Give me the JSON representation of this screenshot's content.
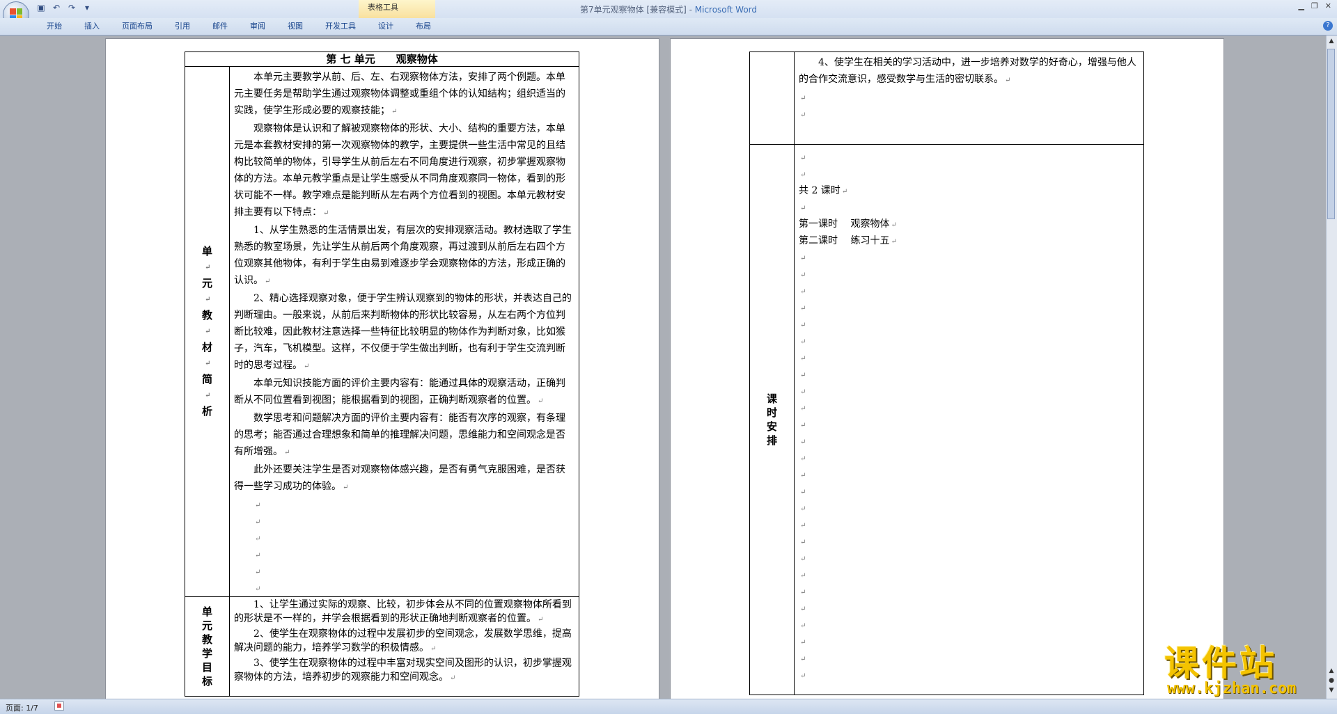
{
  "titlebar": {
    "doc_name": "第7单元观察物体 [兼容模式]",
    "separator": " - ",
    "app_name": "Microsoft Word",
    "context_group": "表格工具"
  },
  "quick_access": {
    "save_icon": "save-icon",
    "undo_icon": "undo-icon",
    "redo_icon": "redo-icon"
  },
  "ribbon": {
    "tabs": [
      "开始",
      "插入",
      "页面布局",
      "引用",
      "邮件",
      "审阅",
      "视图",
      "开发工具",
      "设计",
      "布局"
    ]
  },
  "page1": {
    "title": "第 七 单元　　观察物体",
    "section1_label": [
      "单",
      "元",
      "教",
      "材",
      "简",
      "析"
    ],
    "section1_paragraphs": [
      "本单元主要教学从前、后、左、右观察物体方法，安排了两个例题。本单元主要任务是帮助学生通过观察物体调整或重组个体的认知结构；组织适当的实践，使学生形成必要的观察技能；",
      "观察物体是认识和了解被观察物体的形状、大小、结构的重要方法，本单元是本套教材安排的第一次观察物体的教学，主要提供一些生活中常见的且结构比较简单的物体，引导学生从前后左右不同角度进行观察，初步掌握观察物体的方法。本单元教学重点是让学生感受从不同角度观察同一物体，看到的形状可能不一样。教学难点是能判断从左右两个方位看到的视图。本单元教材安排主要有以下特点：",
      "1、从学生熟悉的生活情景出发，有层次的安排观察活动。教材选取了学生熟悉的教室场景，先让学生从前后两个角度观察，再过渡到从前后左右四个方位观察其他物体，有利于学生由易到难逐步学会观察物体的方法，形成正确的认识。",
      "2、精心选择观察对象，便于学生辨认观察到的物体的形状，并表达自己的判断理由。一般来说，从前后来判断物体的形状比较容易，从左右两个方位判断比较难，因此教材注意选择一些特征比较明显的物体作为判断对象，比如猴子，汽车，飞机模型。这样，不仅便于学生做出判断，也有利于学生交流判断时的思考过程。",
      "本单元知识技能方面的评价主要内容有：能通过具体的观察活动，正确判断从不同位置看到视图；能根据看到的视图，正确判断观察者的位置。",
      "数学思考和问题解决方面的评价主要内容有：能否有次序的观察，有条理的思考；能否通过合理想象和简单的推理解决问题，思维能力和空间观念是否有所增强。",
      "此外还要关注学生是否对观察物体感兴趣，是否有勇气克服困难，是否获得一些学习成功的体验。"
    ],
    "section2_label": [
      "单",
      "元",
      "教",
      "学",
      "目",
      "标"
    ],
    "section2_paragraphs": [
      "1、让学生通过实际的观察、比较，初步体会从不同的位置观察物体所看到的形状是不一样的，并学会根据看到的形状正确地判断观察者的位置。",
      "2、使学生在观察物体的过程中发展初步的空间观念，发展数学思维，提高解决问题的能力，培养学习数学的积极情感。",
      "3、使学生在观察物体的过程中丰富对现实空间及图形的认识，初步掌握观察物体的方法，培养初步的观察能力和空间观念。"
    ]
  },
  "page2": {
    "goal4": "4、使学生在相关的学习活动中，进一步培养对数学的好奇心，增强与他人的合作交流意识，感受数学与生活的密切联系。",
    "schedule_label": [
      "课",
      "时",
      "安",
      "排"
    ],
    "total_hours": "共 2 课时",
    "lesson1": "第一课时　 观察物体",
    "lesson2": "第二课时　 练习十五"
  },
  "statusbar": {
    "page_info": "页面: 1/7"
  },
  "watermark": {
    "brand": "课件站",
    "url": "www.kjzhan.com"
  },
  "colors": {
    "accent": "#3b6db4",
    "ribbon_bg": "#dfe9f5",
    "workspace_bg": "#abafb6",
    "watermark_gold": "#f4c300"
  }
}
